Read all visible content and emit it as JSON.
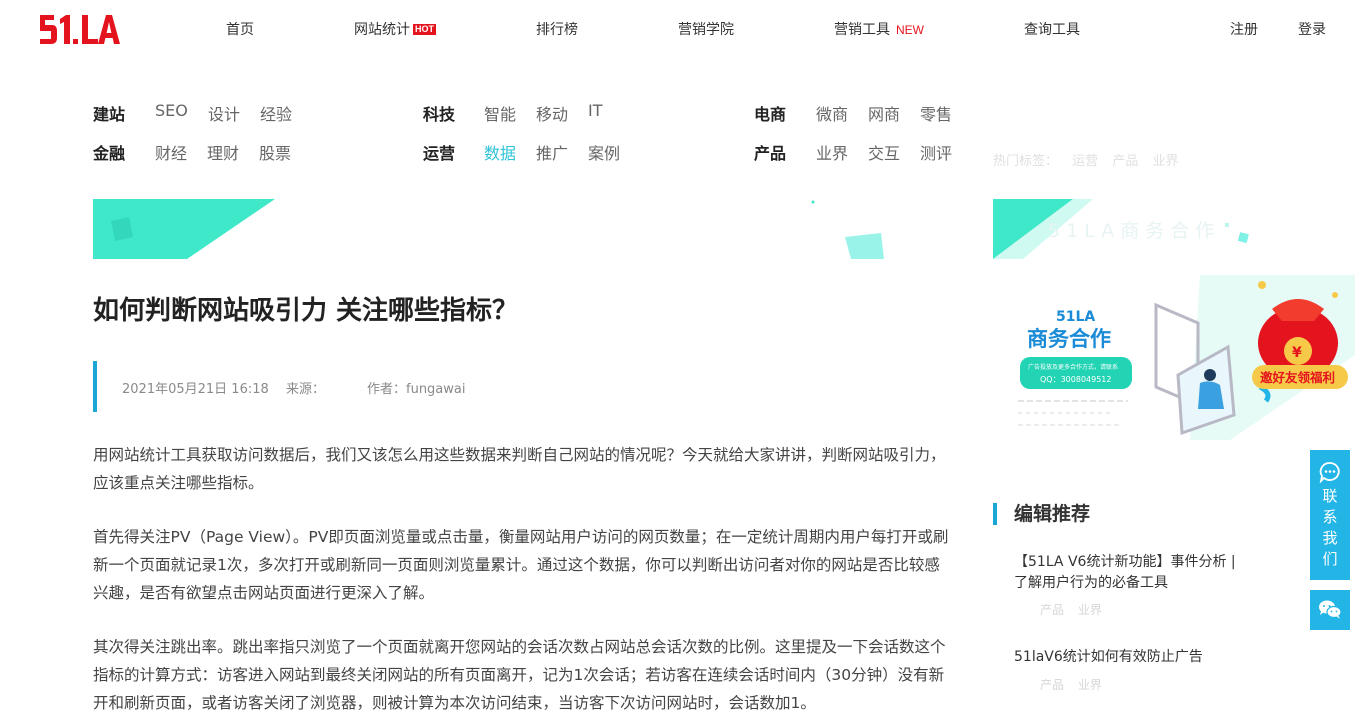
{
  "brand": {
    "logo_text": "51.LA"
  },
  "nav": {
    "home": "首页",
    "stats": "网站统计",
    "stats_badge": "HOT",
    "ranking": "排行榜",
    "academy": "营销学院",
    "tools": "营销工具",
    "tools_badge": "NEW",
    "query": "查询工具",
    "register": "注册",
    "login": "登录"
  },
  "categories": {
    "row1": [
      {
        "main": "建站",
        "subs": [
          "SEO",
          "设计",
          "经验"
        ]
      },
      {
        "main": "科技",
        "subs": [
          "智能",
          "移动",
          "IT"
        ]
      },
      {
        "main": "电商",
        "subs": [
          "微商",
          "网商",
          "零售"
        ]
      }
    ],
    "row2": [
      {
        "main": "金融",
        "subs": [
          "财经",
          "理财",
          "股票"
        ]
      },
      {
        "main": "运营",
        "subs": [
          "数据",
          "推广",
          "案例"
        ],
        "active_sub": "数据"
      },
      {
        "main": "产品",
        "subs": [
          "业界",
          "交互",
          "测评"
        ]
      }
    ]
  },
  "article": {
    "title": "如何判断网站吸引力 关注哪些指标？",
    "date": "2021年05月21日 16:18",
    "source_label": "来源：",
    "author": "作者：fungawai",
    "paragraphs": [
      "用网站统计工具获取访问数据后，我们又该怎么用这些数据来判断自己网站的情况呢？今天就给大家讲讲，判断网站吸引力，应该重点关注哪些指标。",
      "首先得关注PV（Page View）。PV即页面浏览量或点击量，衡量网站用户访问的网页数量；在一定统计周期内用户每打开或刷新一个页面就记录1次，多次打开或刷新同一页面则浏览量累计。通过这个数据，你可以判断出访问者对你的网站是否比较感兴趣，是否有欲望点击网站页面进行更深入了解。",
      "其次得关注跳出率。跳出率指只浏览了一个页面就离开您网站的会话次数占网站总会话次数的比例。这里提及一下会话数这个指标的计算方式：访客进入网站到最终关闭网站的所有页面离开，记为1次会话；若访客在连续会话时间内（30分钟）没有新开和刷新页面，或者访客关闭了浏览器，则被计算为本次访问结束，当访客下次访问网站时，会话数加1。"
    ]
  },
  "sidebar": {
    "hot_tags_label": "热门标签：",
    "hot_tags": [
      "运营",
      "产品",
      "业界"
    ],
    "banner1_text": "51LA商务合作",
    "promo": {
      "brand": "51LA",
      "title": "商务合作",
      "pill_line1": "广告投放及更多合作方式，请联系",
      "pill_line2": "QQ：3008049512",
      "gift_label": "邀好友领福利"
    },
    "section_title": "编辑推荐",
    "recommendations": [
      {
        "title": "【51LA V6统计新功能】事件分析 | 了解用户行为的必备工具",
        "tags": [
          "产品",
          "业界"
        ]
      },
      {
        "title": "51laV6统计如何有效防止广告",
        "tags": [
          "产品",
          "业界"
        ]
      }
    ]
  },
  "float": {
    "contact_chars": [
      "联",
      "系",
      "我",
      "们"
    ]
  },
  "colors": {
    "accent": "#22b5e6",
    "brand_red": "#e4141e",
    "active_link": "#30c3d7",
    "mint": "#3ee8c8"
  }
}
